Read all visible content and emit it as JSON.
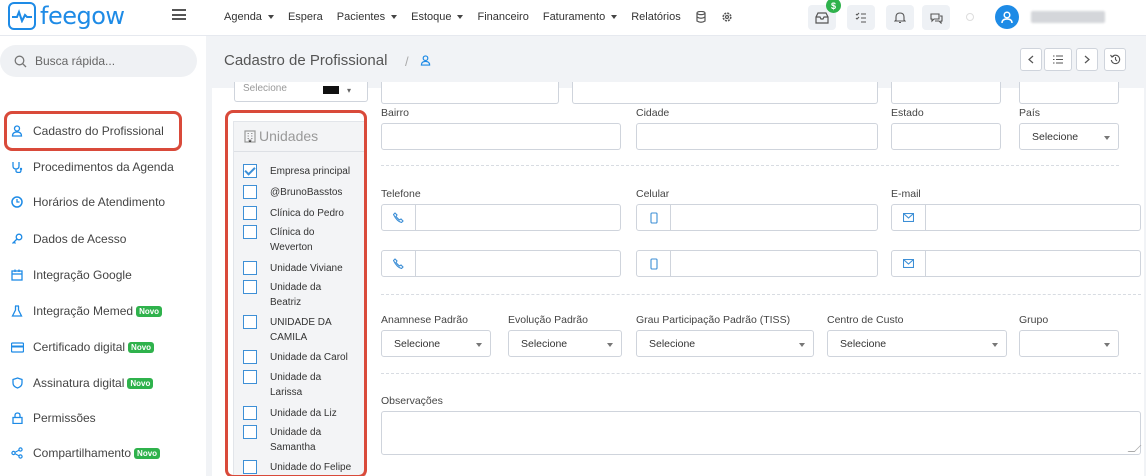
{
  "app": {
    "logo_text": "feegow"
  },
  "topnav": {
    "items": [
      {
        "label": "Agenda",
        "caret": true
      },
      {
        "label": "Espera",
        "caret": false
      },
      {
        "label": "Pacientes",
        "caret": true
      },
      {
        "label": "Estoque",
        "caret": true
      },
      {
        "label": "Financeiro",
        "caret": false
      },
      {
        "label": "Faturamento",
        "caret": true
      },
      {
        "label": "Relatórios",
        "caret": false
      }
    ],
    "badge": "$"
  },
  "sidebar": {
    "search_placeholder": "Busca rápida...",
    "items": [
      {
        "label": "Cadastro do Profissional",
        "icon": "user-icon",
        "novo": false
      },
      {
        "label": "Procedimentos da Agenda",
        "icon": "stethoscope-icon",
        "novo": false
      },
      {
        "label": "Horários de Atendimento",
        "icon": "clock-icon",
        "novo": false
      },
      {
        "label": "Dados de Acesso",
        "icon": "key-icon",
        "novo": false
      },
      {
        "label": "Integração Google",
        "icon": "calendar-icon",
        "novo": false
      },
      {
        "label": "Integração Memed",
        "icon": "flask-icon",
        "novo": true
      },
      {
        "label": "Certificado digital",
        "icon": "card-icon",
        "novo": true
      },
      {
        "label": "Assinatura digital",
        "icon": "shield-icon",
        "novo": true
      },
      {
        "label": "Permissões",
        "icon": "lock-icon",
        "novo": false
      },
      {
        "label": "Compartilhamento",
        "icon": "share-icon",
        "novo": true
      }
    ],
    "novo_label": "Novo"
  },
  "page": {
    "title": "Cadastro de Profissional",
    "separator": "/"
  },
  "units": {
    "title": "Unidades",
    "items": [
      {
        "label": "Empresa principal",
        "checked": true
      },
      {
        "label": "@BrunoBasstos",
        "checked": false
      },
      {
        "label": "Clínica do Pedro",
        "checked": false
      },
      {
        "label": "Clínica do\nWeverton",
        "checked": false
      },
      {
        "label": "Unidade Viviane",
        "checked": false
      },
      {
        "label": "Unidade da\nBeatriz",
        "checked": false
      },
      {
        "label": "UNIDADE DA\nCAMILA",
        "checked": false
      },
      {
        "label": "Unidade da Carol",
        "checked": false
      },
      {
        "label": "Unidade da\nLarissa",
        "checked": false
      },
      {
        "label": "Unidade da Liz",
        "checked": false
      },
      {
        "label": "Unidade da\nSamantha",
        "checked": false
      },
      {
        "label": "Unidade do Felipe",
        "checked": false
      }
    ]
  },
  "form": {
    "top_select_value": "Selecione",
    "bairro_label": "Bairro",
    "cidade_label": "Cidade",
    "estado_label": "Estado",
    "pais_label": "País",
    "pais_value": "Selecione",
    "telefone_label": "Telefone",
    "celular_label": "Celular",
    "email_label": "E-mail",
    "anamnese_label": "Anamnese Padrão",
    "anamnese_value": "Selecione",
    "evolucao_label": "Evolução Padrão",
    "evolucao_value": "Selecione",
    "grau_label": "Grau Participação Padrão (TISS)",
    "grau_value": "Selecione",
    "centro_label": "Centro de Custo",
    "centro_value": "Selecione",
    "grupo_label": "Grupo",
    "grupo_value": "",
    "observacoes_label": "Observações"
  },
  "colors": {
    "accent": "#1e8be6",
    "highlight": "#d94a3a",
    "novo": "#2fb24c"
  }
}
